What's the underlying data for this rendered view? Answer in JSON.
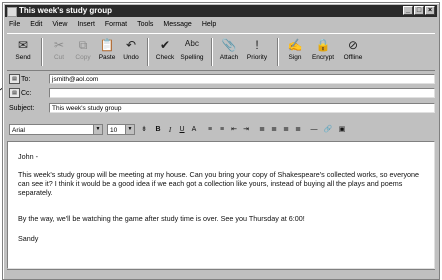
{
  "window": {
    "title": "This week's study group"
  },
  "menu": [
    "File",
    "Edit",
    "View",
    "Insert",
    "Format",
    "Tools",
    "Message",
    "Help"
  ],
  "toolbar": [
    {
      "label": "Send",
      "icon": "send-icon",
      "glyph": "✉",
      "enabled": true
    },
    {
      "label": "Cut",
      "icon": "cut-icon",
      "glyph": "✂",
      "enabled": false
    },
    {
      "label": "Copy",
      "icon": "copy-icon",
      "glyph": "⧉",
      "enabled": false
    },
    {
      "label": "Paste",
      "icon": "paste-icon",
      "glyph": "📋",
      "enabled": true
    },
    {
      "label": "Undo",
      "icon": "undo-icon",
      "glyph": "↶",
      "enabled": true
    },
    {
      "label": "Check",
      "icon": "check-names-icon",
      "glyph": "✔",
      "enabled": true
    },
    {
      "label": "Spelling",
      "icon": "spelling-icon",
      "glyph": "ᴬᵇᶜ",
      "enabled": true
    },
    {
      "label": "Attach",
      "icon": "paperclip-icon",
      "glyph": "📎",
      "enabled": true
    },
    {
      "label": "Priority",
      "icon": "priority-icon",
      "glyph": "!",
      "enabled": true
    },
    {
      "label": "Sign",
      "icon": "sign-icon",
      "glyph": "✍",
      "enabled": true
    },
    {
      "label": "Encrypt",
      "icon": "encrypt-icon",
      "glyph": "🔒",
      "enabled": true
    },
    {
      "label": "Offline",
      "icon": "offline-icon",
      "glyph": "⊘",
      "enabled": true
    }
  ],
  "headers": {
    "to_label": "To:",
    "to_value": "jsmith@aol.com",
    "cc_label": "Cc:",
    "cc_value": "",
    "subject_label": "Subject:",
    "subject_value": "This week's study group"
  },
  "format": {
    "font": "Arial",
    "size": "10",
    "buttons": [
      "B",
      "I",
      "U",
      "A",
      "≡",
      "≡",
      "⇤",
      "⇥",
      "≣",
      "≣",
      "≣",
      "≣",
      "—",
      "🔗",
      "▣"
    ]
  },
  "body": {
    "greeting": "John -",
    "paragraph1": "This week's study group will be meeting at my house. Can you bring your copy of Shakespeare's collected works, so everyone can see it? I think it would be a good idea if we each got a collection like yours, instead of buying all the plays and poems separately.",
    "paragraph2": "By the way, we'll be watching the game after study time is over. See you Thursday at 6:00!",
    "signature": "Sandy"
  }
}
